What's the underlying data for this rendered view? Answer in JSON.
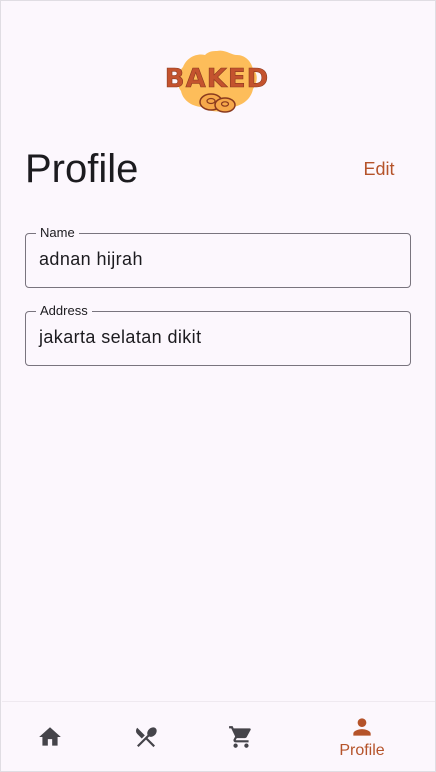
{
  "app": {
    "logo_text": "BAKED",
    "accent_color": "#b5532a"
  },
  "header": {
    "title": "Profile",
    "edit_label": "Edit"
  },
  "form": {
    "name_label": "Name",
    "name_value": "adnan hijrah",
    "address_label": "Address",
    "address_value": "jakarta selatan dikit"
  },
  "bottom_nav": {
    "items": [
      {
        "icon": "home-icon",
        "label": ""
      },
      {
        "icon": "utensils-icon",
        "label": ""
      },
      {
        "icon": "cart-icon",
        "label": ""
      },
      {
        "icon": "person-icon",
        "label": "Profile",
        "active": true
      }
    ]
  }
}
